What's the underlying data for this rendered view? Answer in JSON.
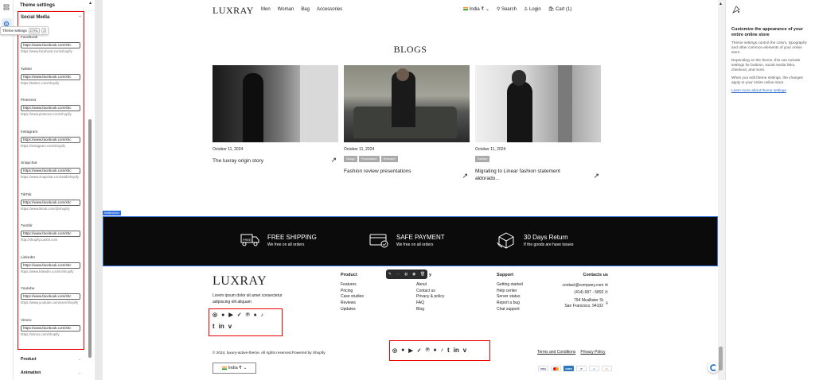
{
  "panel": {
    "header": "Theme settings",
    "tooltip": {
      "label": "Theme settings",
      "key1": "CTRL",
      "key2": "2"
    },
    "section_title": "Social Media",
    "items": [
      {
        "label": "Facebook",
        "value": "https://www.facebook.com/shc",
        "hint": "https://www.facebook.com/shopify"
      },
      {
        "label": "Twitter",
        "value": "https://www.facebook.com/shc",
        "hint": "https://twitter.com/shopify"
      },
      {
        "label": "Pinterest",
        "value": "https://www.facebook.com/shc",
        "hint": "https://www.pinterest.com/shopify"
      },
      {
        "label": "Instagram",
        "value": "https://www.facebook.com/shc",
        "hint": "https://instagram.com/shopify"
      },
      {
        "label": "Snapchat",
        "value": "https://www.facebook.com/shc",
        "hint": "https://www.snapchat.com/add/shopify"
      },
      {
        "label": "TikTok",
        "value": "https://www.facebook.com/shc",
        "hint": "https://www.tiktok.com/@shopify"
      },
      {
        "label": "Tumblr",
        "value": "https://www.facebook.com/shc",
        "hint": "http://shopify.tumblr.com"
      },
      {
        "label": "LinkedIn",
        "value": "https://www.facebook.com/shc",
        "hint": "https://www.linkedin.com/in/shopify"
      },
      {
        "label": "Youtube",
        "value": "https://www.facebook.com/shc",
        "hint": "https://www.youtube.com/user/shopify"
      },
      {
        "label": "Vimeo",
        "value": "https://www.facebook.com/shc",
        "hint": "https://vimeo.com/shopify"
      }
    ],
    "collapsed": [
      "Product",
      "Animation"
    ]
  },
  "store": {
    "logo": "LUXRAY",
    "nav": [
      "Men",
      "Woman",
      "Bag",
      "Accessories"
    ],
    "country": "India ₹",
    "search": "Search",
    "login": "Login",
    "cart": "Cart (1)",
    "blogs_title": "BLOGS",
    "posts": [
      {
        "date": "October 11, 2024",
        "tags": [],
        "title": "The luxray origin story"
      },
      {
        "date": "October 11, 2024",
        "tags": [
          "Design",
          "Presentation",
          "Research"
        ],
        "title": "Fashion review presentations"
      },
      {
        "date": "October 11, 2024",
        "tags": [
          "Fashion"
        ],
        "title": "Migrating to Linear fashion statement aldorado..."
      }
    ],
    "multicolumn_badge": "Multicolumn",
    "features": [
      {
        "title": "FREE SHIPPING",
        "subtitle": "We free on all orders"
      },
      {
        "title": "SAFE PAYMENT",
        "subtitle": "We free on all orders"
      },
      {
        "title": "30 Days Return",
        "subtitle": "If the goods are have issues"
      }
    ],
    "footer": {
      "logo": "LUXRAY",
      "description": "Lorem ipsum dolor sit amet consectetur adipiscing elit aliquam",
      "columns": [
        {
          "heading": "Product",
          "links": [
            "Features",
            "Pricing",
            "Case studies",
            "Reviews",
            "Updates"
          ]
        },
        {
          "heading": "y",
          "links": [
            "About",
            "Contact us",
            "Privacy & policy",
            "FAQ",
            "Blog"
          ]
        },
        {
          "heading": "Support",
          "links": [
            "Getting started",
            "Help center",
            "Server status",
            "Report a bug",
            "Chat support"
          ]
        }
      ],
      "contact": {
        "heading": "Contacts us",
        "email": "contact@company.com",
        "phone": "(414) 687 - 5892",
        "address_1": "794 Mcallister St",
        "address_2": "San Francisco, 94102"
      },
      "copyright": "© 2024, luxury-active-theme. All rights reserved.Powered by Shopify",
      "legal": [
        "Terms and Conditions",
        "Privacy Policy"
      ],
      "country": "India ₹",
      "payments": [
        "VISA",
        "MC",
        "AMEX",
        "P",
        "GPay",
        "DISC"
      ]
    }
  },
  "right_panel": {
    "title": "Customize the appearance of your entire online store",
    "p1": "Theme settings control the colors, typography and other common elements of your online store.",
    "p2": "Depending on the theme, this can include settings for buttons, social media links, checkout, and more.",
    "p3": "When you edit theme settings, the changes apply to your entire online store.",
    "link": "Learn more about theme settings"
  }
}
